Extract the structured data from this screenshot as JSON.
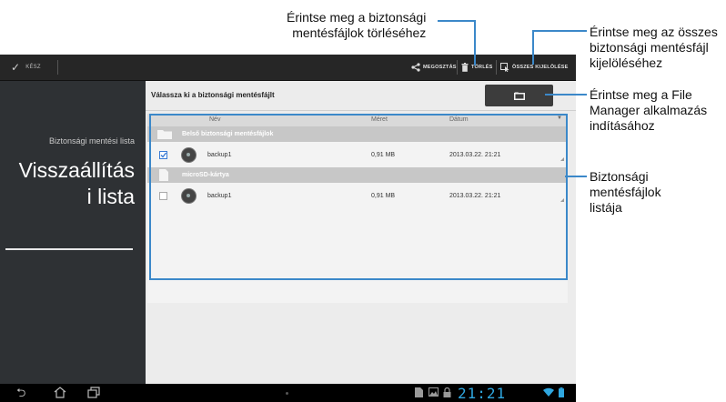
{
  "callouts": {
    "delete": [
      "Érintse meg a biztonsági",
      "mentésfájlok törléséhez"
    ],
    "select_all": [
      "Érintse meg az összes",
      "biztonsági mentésfájl",
      "kijelöléséhez"
    ],
    "file_manager": [
      "Érintse meg a File",
      "Manager alkalmazás",
      "indításához"
    ],
    "list": [
      "Biztonsági",
      "mentésfájlok",
      "listája"
    ]
  },
  "actionbar": {
    "done_label": "KÉSZ",
    "share_label": "MEGOSZTÁS",
    "delete_label": "TÖRLÉS",
    "select_all_label": "ÖSSZES KIJELÖLÉSE"
  },
  "sidebar": {
    "list_label": "Biztonsági mentési lista",
    "title_line1": "Visszaállítás",
    "title_line2": "i lista"
  },
  "main": {
    "header": "Válassza ki a biztonsági mentésfájlt",
    "columns": [
      "Név",
      "Méret",
      "Dátum"
    ],
    "groups": [
      {
        "name": "Belső biztonsági mentésfájlok",
        "files": [
          {
            "name": "backup1",
            "size": "0,91 MB",
            "date": "2013.03.22. 21:21",
            "checked": true
          }
        ]
      },
      {
        "name": "microSD-kártya",
        "files": [
          {
            "name": "backup1",
            "size": "0,91 MB",
            "date": "2013.03.22. 21:21",
            "checked": false
          }
        ]
      }
    ]
  },
  "statusbar": {
    "clock": "21:21"
  },
  "colors": {
    "accent_blue": "#3b88c9",
    "clock_blue": "#2fa7e0",
    "checkbox_blue": "#3a7bd5"
  }
}
